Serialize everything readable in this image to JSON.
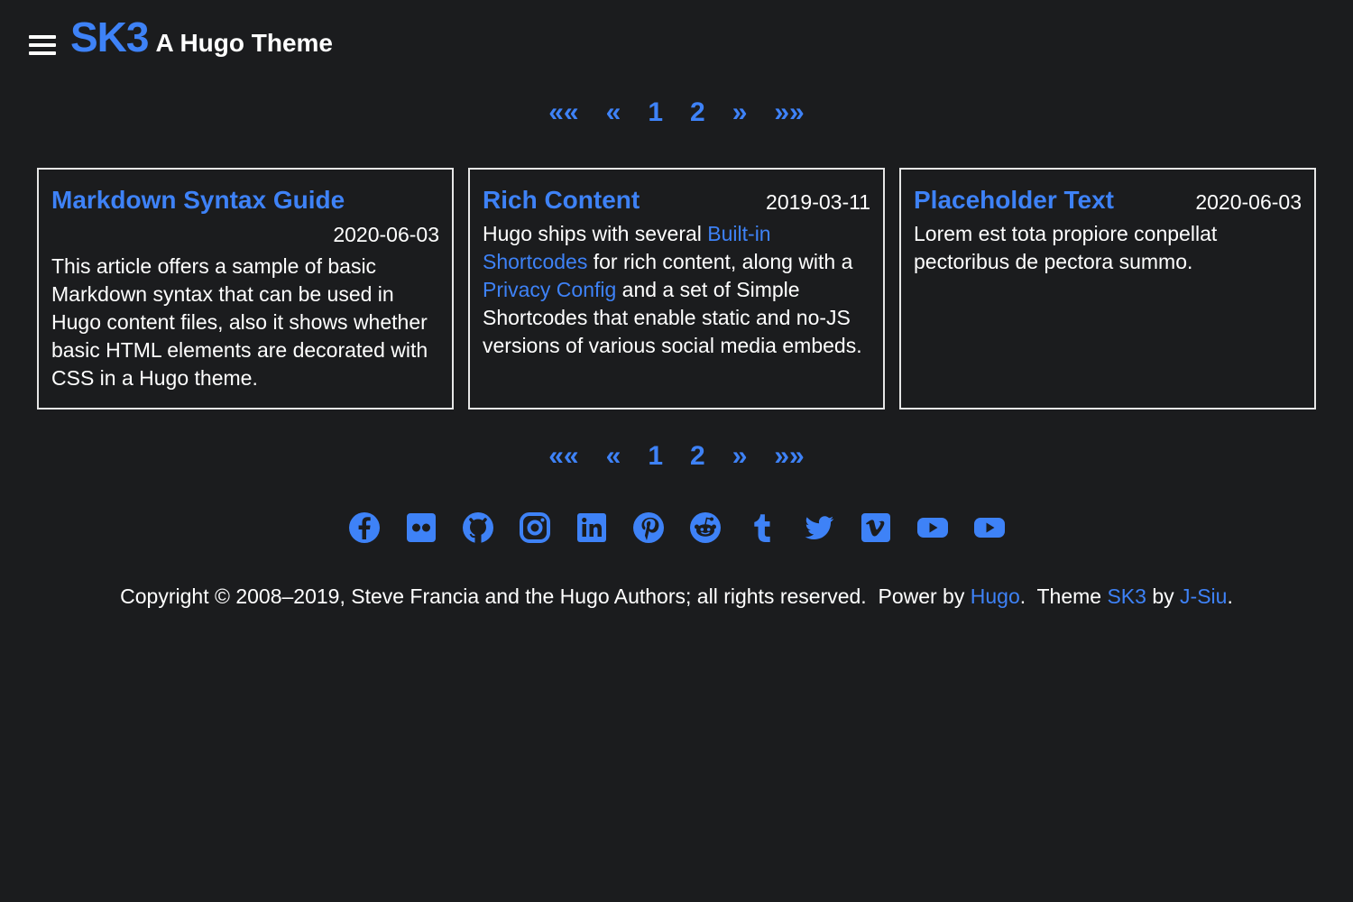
{
  "header": {
    "menu_icon": "hamburger-menu-icon",
    "logo": "SK3",
    "subtitle": "A Hugo Theme"
  },
  "pagination": {
    "first": "««",
    "prev": "«",
    "pages": [
      "1",
      "2"
    ],
    "next": "»",
    "last": "»»"
  },
  "posts": [
    {
      "title": "Markdown Syntax Guide",
      "date": "2020-06-03",
      "summary": "This article offers a sample of basic Markdown syntax that can be used in Hugo content files, also it shows whether basic HTML elements are decorated with CSS in a Hugo theme."
    },
    {
      "title": "Rich Content",
      "date": "2019-03-11",
      "summary_parts": {
        "t1": "Hugo ships with several ",
        "link1": "Built-in Shortcodes",
        "t2": " for rich content, along with a ",
        "link2": "Privacy Config",
        "t3": " and a set of Simple Shortcodes that enable static and no-JS versions of various social media embeds."
      }
    },
    {
      "title": "Placeholder Text",
      "date": "2020-06-03",
      "summary": "Lorem est tota propiore conpellat pectoribus de pectora summo."
    }
  ],
  "social_icons": [
    "facebook-icon",
    "flickr-icon",
    "github-icon",
    "instagram-icon",
    "linkedin-icon",
    "pinterest-icon",
    "reddit-icon",
    "tumblr-icon",
    "twitter-icon",
    "vimeo-icon",
    "youtube-icon",
    "youtube-icon"
  ],
  "footer": {
    "copyright": "Copyright © 2008–2019, Steve Francia and the Hugo Authors; all rights reserved.  Power by ",
    "hugo_link": "Hugo",
    "theme_text": ".  Theme ",
    "theme_link": "SK3",
    "by_text": " by ",
    "author_link": "J-Siu",
    "end": "."
  },
  "colors": {
    "background": "#1b1c1e",
    "accent": "#3e82f7",
    "text": "#ffffff",
    "border": "#e6e6e6"
  }
}
